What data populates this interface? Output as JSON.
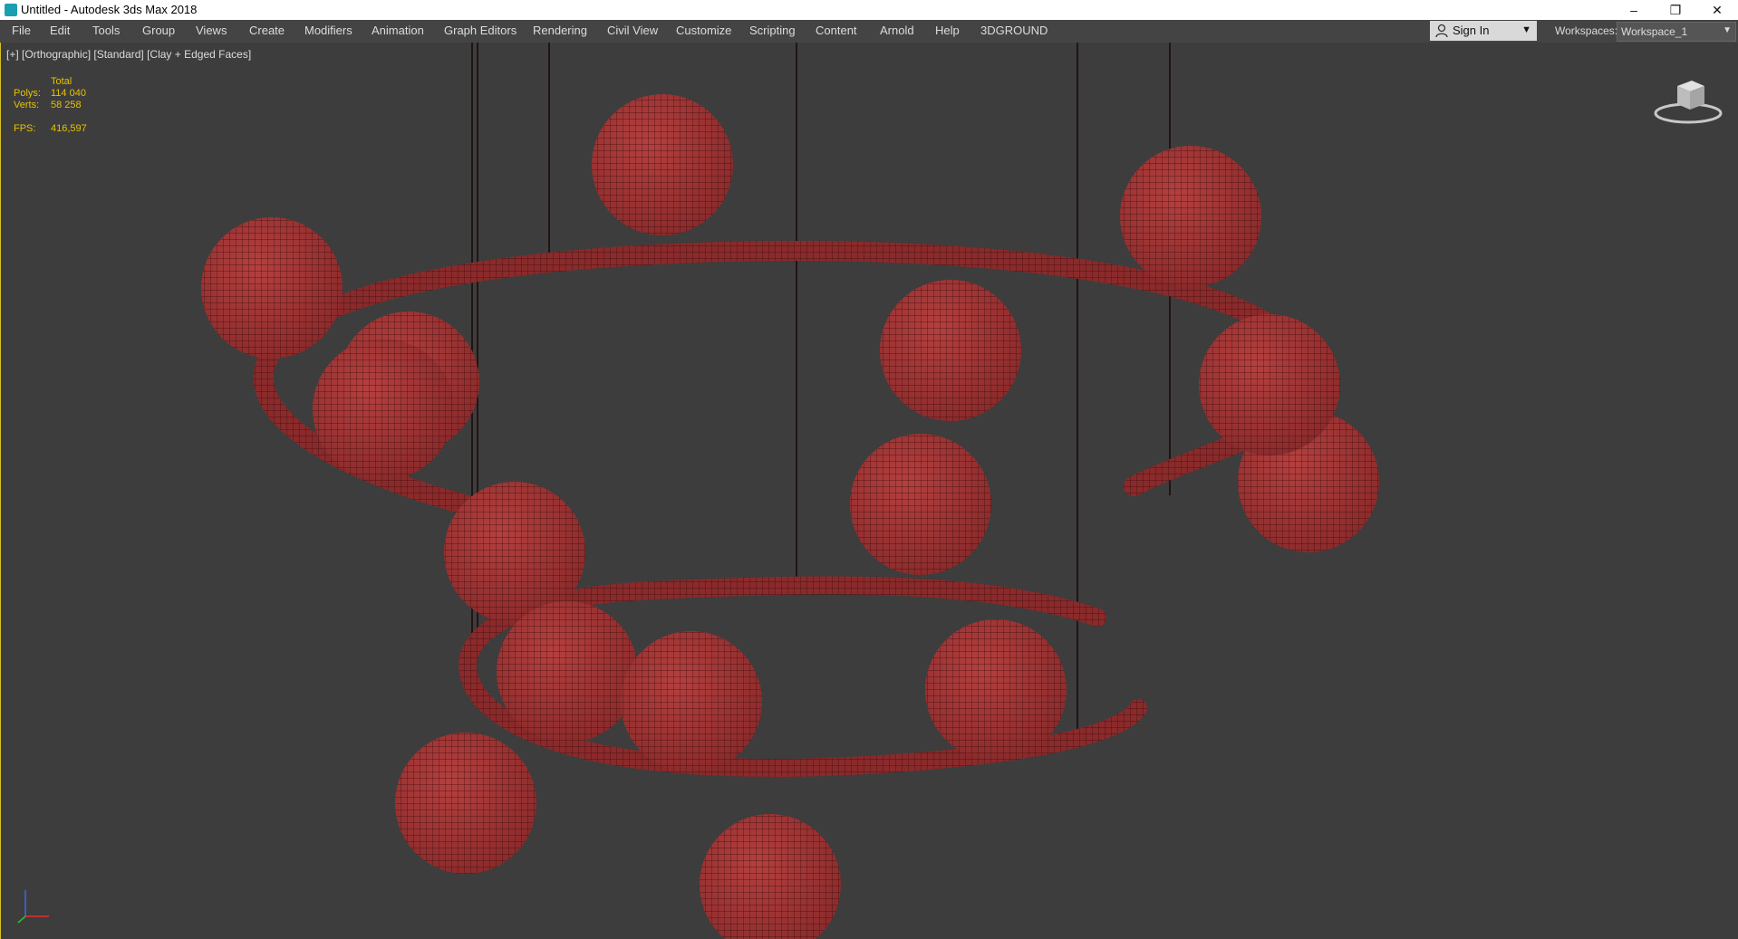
{
  "window": {
    "title": "Untitled - Autodesk 3ds Max 2018",
    "minimize": "–",
    "restore": "❐",
    "close": "✕"
  },
  "menu": {
    "items": [
      "File",
      "Edit",
      "Tools",
      "Group",
      "Views",
      "Create",
      "Modifiers",
      "Animation",
      "Graph Editors",
      "Rendering",
      "Civil View",
      "Customize",
      "Scripting",
      "Content",
      "Arnold",
      "Help",
      "3DGROUND"
    ]
  },
  "account": {
    "sign_in": "Sign In",
    "workspaces_label": "Workspaces:",
    "workspace_value": "Workspace_1"
  },
  "viewport": {
    "label": "[+] [Orthographic] [Standard] [Clay + Edged Faces]",
    "stats": {
      "total_label": "Total",
      "polys_label": "Polys:",
      "polys_value": "114 040",
      "verts_label": "Verts:",
      "verts_value": "58 258",
      "fps_label": "FPS:",
      "fps_value": "416,597"
    }
  },
  "colors": {
    "menubar": "#444444",
    "viewport_bg": "#3d3d3d",
    "stats_text": "#e8c200",
    "model_fill": "#a7383a",
    "wire": "#3a0c0c"
  },
  "icons": {
    "app": "3dsmax-app-icon",
    "sign_in": "person-icon",
    "viewcube": "viewcube-icon",
    "axis": "axis-tripod-icon"
  }
}
